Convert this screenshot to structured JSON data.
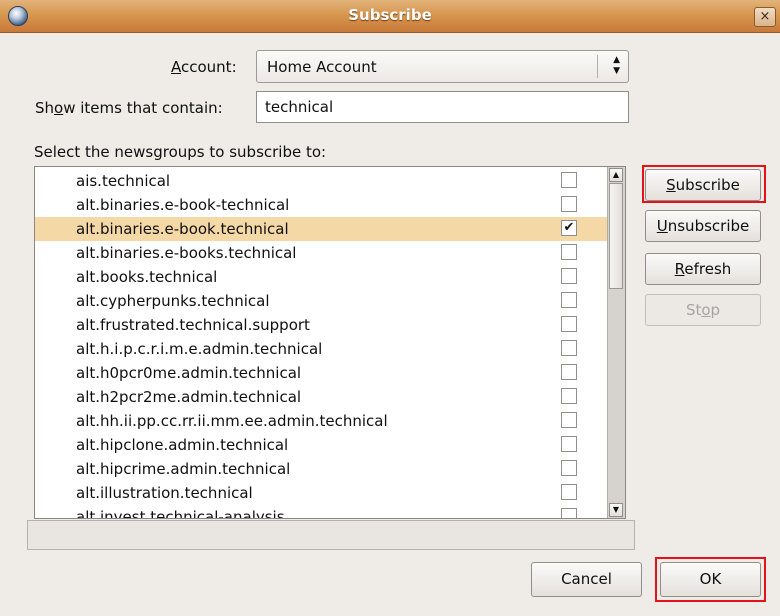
{
  "window": {
    "title": "Subscribe",
    "close_label": "×"
  },
  "account": {
    "label_pre": "",
    "label_u": "A",
    "label_post": "ccount:",
    "value": "Home Account",
    "arrows_up": "▲",
    "arrows_down": "▼"
  },
  "filter": {
    "label_pre": "Sh",
    "label_u": "o",
    "label_post": "w items that contain:",
    "value": "technical"
  },
  "list": {
    "caption": "Select the newsgroups to subscribe to:",
    "items": [
      {
        "label": "ais.technical",
        "checked": ""
      },
      {
        "label": "alt.binaries.e-book-technical",
        "checked": ""
      },
      {
        "label": "alt.binaries.e-book.technical",
        "checked": "✔"
      },
      {
        "label": "alt.binaries.e-books.technical",
        "checked": ""
      },
      {
        "label": "alt.books.technical",
        "checked": ""
      },
      {
        "label": "alt.cypherpunks.technical",
        "checked": ""
      },
      {
        "label": "alt.frustrated.technical.support",
        "checked": ""
      },
      {
        "label": "alt.h.i.p.c.r.i.m.e.admin.technical",
        "checked": ""
      },
      {
        "label": "alt.h0pcr0me.admin.technical",
        "checked": ""
      },
      {
        "label": "alt.h2pcr2me.admin.technical",
        "checked": ""
      },
      {
        "label": "alt.hh.ii.pp.cc.rr.ii.mm.ee.admin.technical",
        "checked": ""
      },
      {
        "label": "alt.hipclone.admin.technical",
        "checked": ""
      },
      {
        "label": "alt.hipcrime.admin.technical",
        "checked": ""
      },
      {
        "label": "alt.illustration.technical",
        "checked": ""
      },
      {
        "label": "alt.invest.technical-analysis",
        "checked": ""
      }
    ],
    "scroll_up": "▲",
    "scroll_down": "▼"
  },
  "buttons": {
    "subscribe": {
      "pre": "",
      "u": "S",
      "post": "ubscribe"
    },
    "unsubscribe": {
      "pre": "",
      "u": "U",
      "post": "nsubscribe"
    },
    "refresh": {
      "pre": "",
      "u": "R",
      "post": "efresh"
    },
    "stop": {
      "pre": "St",
      "u": "o",
      "post": "p"
    },
    "cancel": "Cancel",
    "ok": "OK"
  },
  "colors": {
    "highlight": "#e5121a",
    "selected_row": "#f4d9a6",
    "titlebar": "#d7974e"
  }
}
